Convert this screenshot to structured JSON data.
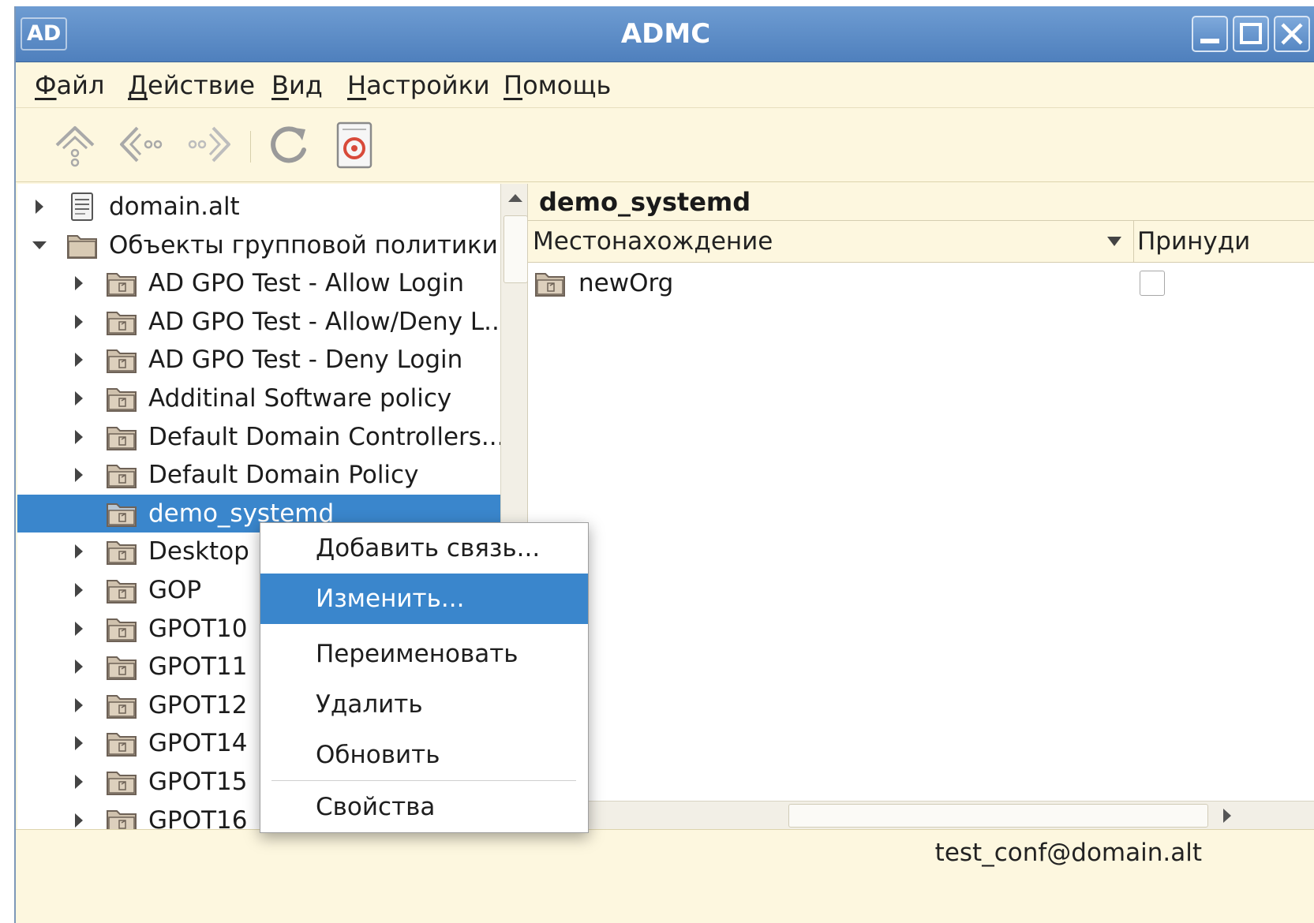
{
  "window": {
    "app_badge": "AD",
    "title": "ADMC"
  },
  "menubar": {
    "items": [
      {
        "first": "Ф",
        "rest": "айл"
      },
      {
        "first": "Д",
        "rest": "ействие"
      },
      {
        "first": "В",
        "rest": "ид"
      },
      {
        "first": "Н",
        "rest": "астройки"
      },
      {
        "first": "П",
        "rest": "омощь"
      }
    ]
  },
  "toolbar": {
    "icons": [
      "navigate-up-icon",
      "back-icon",
      "forward-icon",
      "refresh-icon",
      "console-tree-icon"
    ]
  },
  "tree": {
    "items": [
      {
        "label": "domain.alt",
        "icon": "server-icon",
        "expander": "collapsed"
      },
      {
        "label": "Объекты групповой политики",
        "icon": "folder-icon",
        "expander": "expanded"
      },
      {
        "label": "AD GPO Test - Allow Login",
        "icon": "gpo-icon",
        "expander": "collapsed"
      },
      {
        "label": "AD GPO Test - Allow/Deny L...",
        "icon": "gpo-icon",
        "expander": "collapsed"
      },
      {
        "label": "AD GPO Test - Deny Login",
        "icon": "gpo-icon",
        "expander": "collapsed"
      },
      {
        "label": "Additinal Software policy",
        "icon": "gpo-icon",
        "expander": "collapsed"
      },
      {
        "label": "Default Domain Controllers...",
        "icon": "gpo-icon",
        "expander": "collapsed"
      },
      {
        "label": "Default Domain Policy",
        "icon": "gpo-icon",
        "expander": "collapsed"
      },
      {
        "label": "demo_systemd",
        "icon": "gpo-icon",
        "expander": "none",
        "selected": true
      },
      {
        "label": "Desktop",
        "icon": "gpo-icon",
        "expander": "collapsed"
      },
      {
        "label": "GOP",
        "icon": "gpo-icon",
        "expander": "collapsed"
      },
      {
        "label": "GPOT10",
        "icon": "gpo-icon",
        "expander": "collapsed"
      },
      {
        "label": "GPOT11",
        "icon": "gpo-icon",
        "expander": "collapsed"
      },
      {
        "label": "GPOT12",
        "icon": "gpo-icon",
        "expander": "collapsed"
      },
      {
        "label": "GPOT14",
        "icon": "gpo-icon",
        "expander": "collapsed"
      },
      {
        "label": "GPOT15",
        "icon": "gpo-icon",
        "expander": "collapsed"
      },
      {
        "label": "GPOT16",
        "icon": "gpo-icon",
        "expander": "collapsed"
      }
    ]
  },
  "details": {
    "title": "demo_systemd",
    "columns": {
      "location": "Местонахождение",
      "enforced": "Принуди"
    },
    "rows": [
      {
        "location": "newOrg",
        "enforced": false
      }
    ]
  },
  "context_menu": {
    "items": [
      {
        "label": "Добавить связь..."
      },
      {
        "label": "Изменить...",
        "active": true
      },
      {
        "label": "Переименовать"
      },
      {
        "label": "Удалить"
      },
      {
        "label": "Обновить"
      },
      {
        "label": "Свойства"
      }
    ]
  },
  "status": {
    "user": "test_conf@domain.alt"
  },
  "colors": {
    "selection": "#3a86cc",
    "titlebar": "#5b8ac6",
    "panel_bg": "#fdf7df"
  }
}
